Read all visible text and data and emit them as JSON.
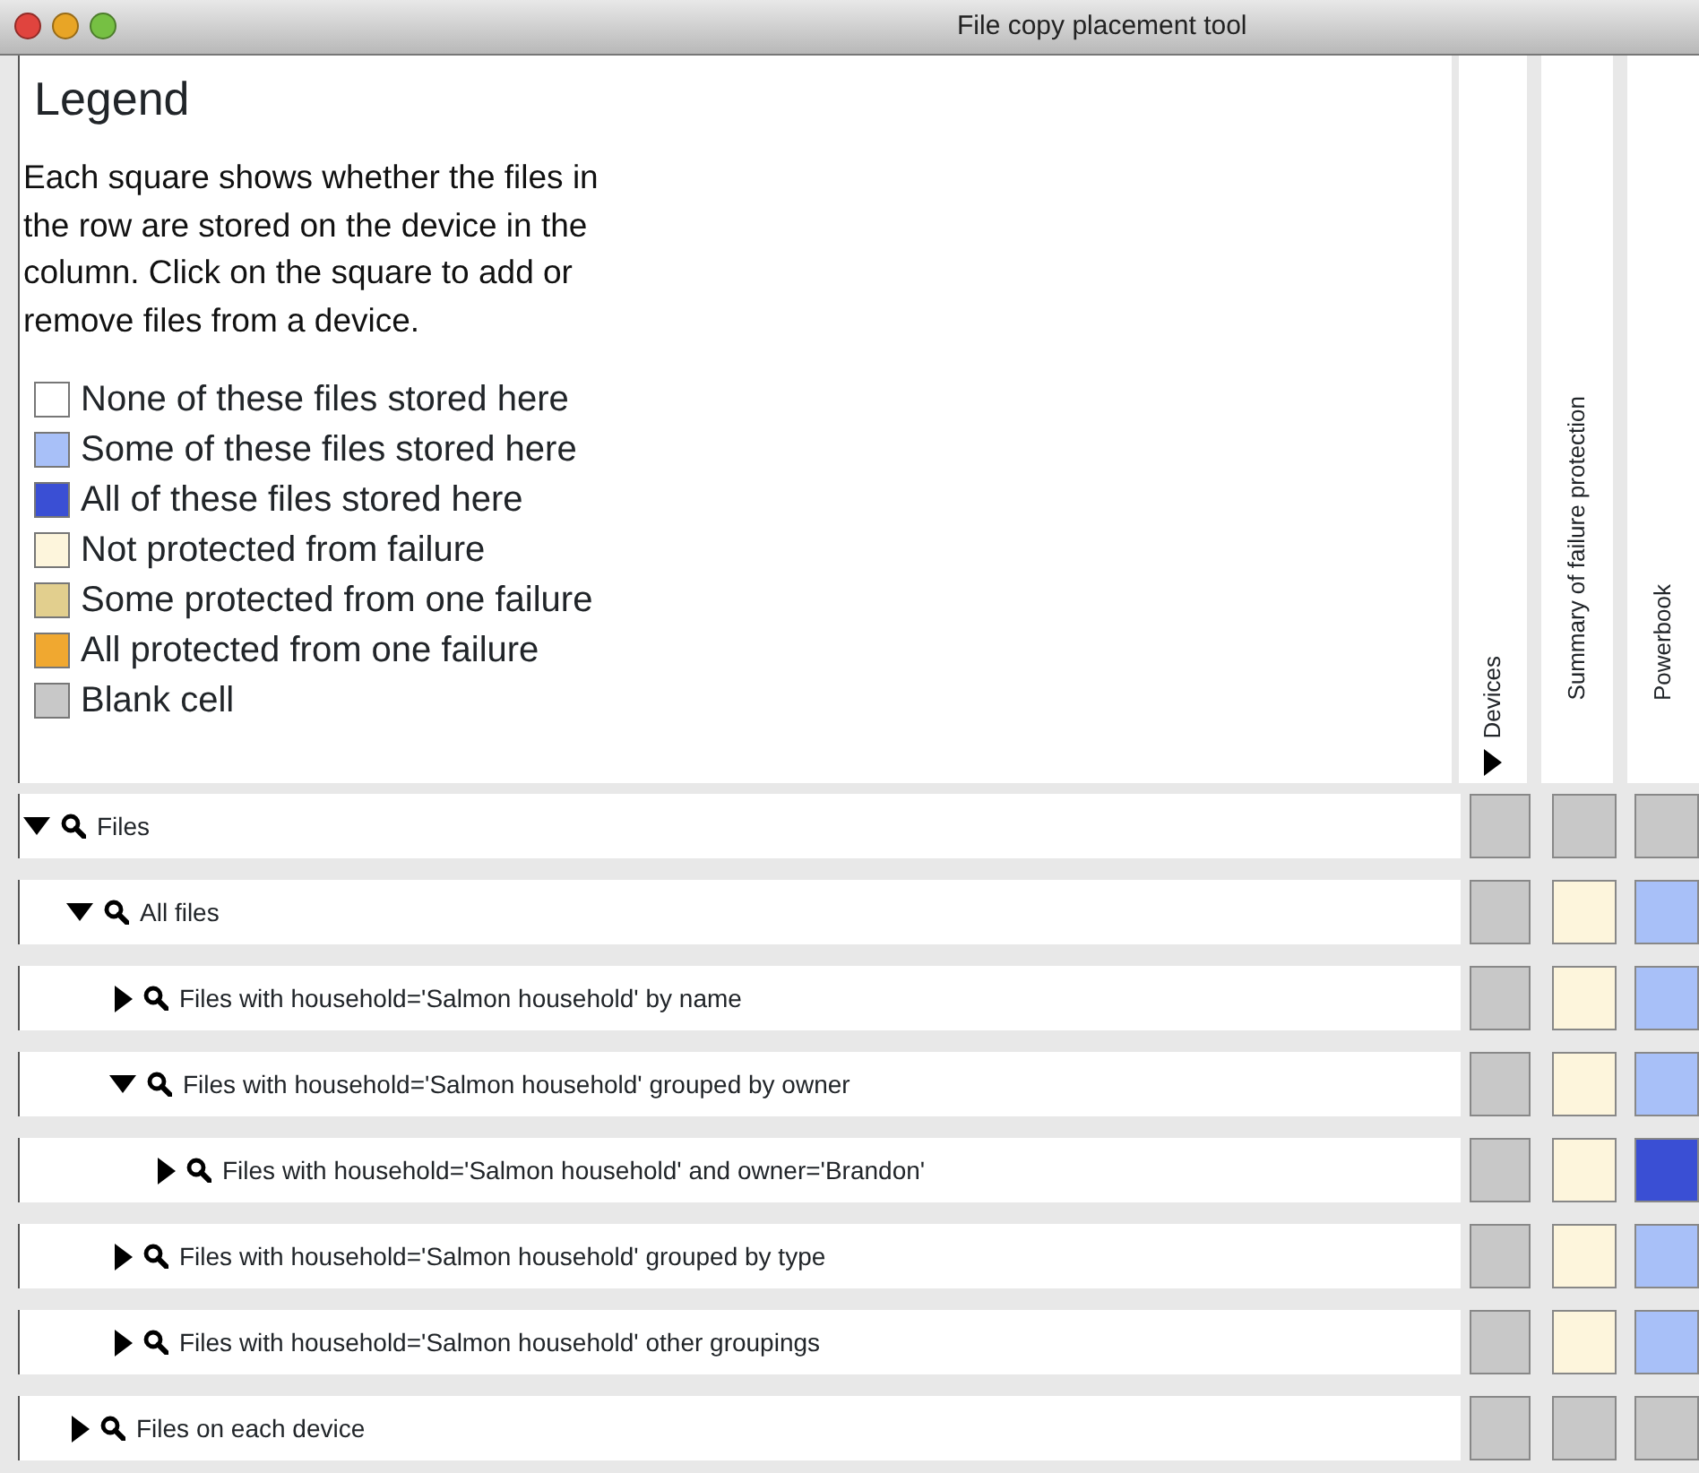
{
  "window": {
    "title": "File copy placement tool"
  },
  "legend": {
    "title": "Legend",
    "description": "Each square shows whether the files in the row are stored on the device in the column. Click on the square to add or remove files from a device.",
    "items": [
      {
        "label": "None of these files stored here",
        "color": "#ffffff"
      },
      {
        "label": "Some of these files stored here",
        "color": "#a8c0f8"
      },
      {
        "label": "All of these files stored here",
        "color": "#3a4fd4"
      },
      {
        "label": "Not protected from failure",
        "color": "#fdf5dc"
      },
      {
        "label": "Some protected from one failure",
        "color": "#e2cf8e"
      },
      {
        "label": "All protected from one failure",
        "color": "#f0a830"
      },
      {
        "label": "Blank cell",
        "color": "#c8c8c8"
      }
    ]
  },
  "columns": [
    {
      "label": "Devices",
      "kind": "expander",
      "expanded": false
    },
    {
      "label": "Summary of failure protection",
      "kind": "plain"
    },
    {
      "label": "Powerbook",
      "kind": "plain"
    }
  ],
  "tree": [
    {
      "label": "Files",
      "expanded": true,
      "cells": [
        {
          "color": "#c8c8c8"
        },
        {
          "color": "#c8c8c8"
        },
        {
          "color": "#c8c8c8"
        }
      ],
      "children": [
        {
          "label": "All files",
          "expanded": true,
          "cells": [
            {
              "color": "#c8c8c8"
            },
            {
              "color": "#fdf5dc"
            },
            {
              "color": "#a8c0f8"
            }
          ],
          "children": [
            {
              "label": "Files with household='Salmon household' by name",
              "expanded": false,
              "cells": [
                {
                  "color": "#c8c8c8"
                },
                {
                  "color": "#fdf5dc"
                },
                {
                  "color": "#a8c0f8"
                }
              ]
            },
            {
              "label": "Files with household='Salmon household' grouped by owner",
              "expanded": true,
              "cells": [
                {
                  "color": "#c8c8c8"
                },
                {
                  "color": "#fdf5dc"
                },
                {
                  "color": "#a8c0f8"
                }
              ],
              "children": [
                {
                  "label": "Files with household='Salmon household' and owner='Brandon'",
                  "expanded": false,
                  "cells": [
                    {
                      "color": "#c8c8c8"
                    },
                    {
                      "color": "#fdf5dc"
                    },
                    {
                      "color": "#3a4fd4"
                    }
                  ]
                }
              ]
            },
            {
              "label": "Files with household='Salmon household' grouped by type",
              "expanded": false,
              "cells": [
                {
                  "color": "#c8c8c8"
                },
                {
                  "color": "#fdf5dc"
                },
                {
                  "color": "#a8c0f8"
                }
              ]
            },
            {
              "label": "Files with household='Salmon household' other groupings",
              "expanded": false,
              "cells": [
                {
                  "color": "#c8c8c8"
                },
                {
                  "color": "#fdf5dc"
                },
                {
                  "color": "#a8c0f8"
                }
              ]
            }
          ]
        },
        {
          "label": "Files on each device",
          "expanded": false,
          "cells": [
            {
              "color": "#c8c8c8"
            },
            {
              "color": "#c8c8c8"
            },
            {
              "color": "#c8c8c8"
            }
          ]
        }
      ]
    }
  ]
}
